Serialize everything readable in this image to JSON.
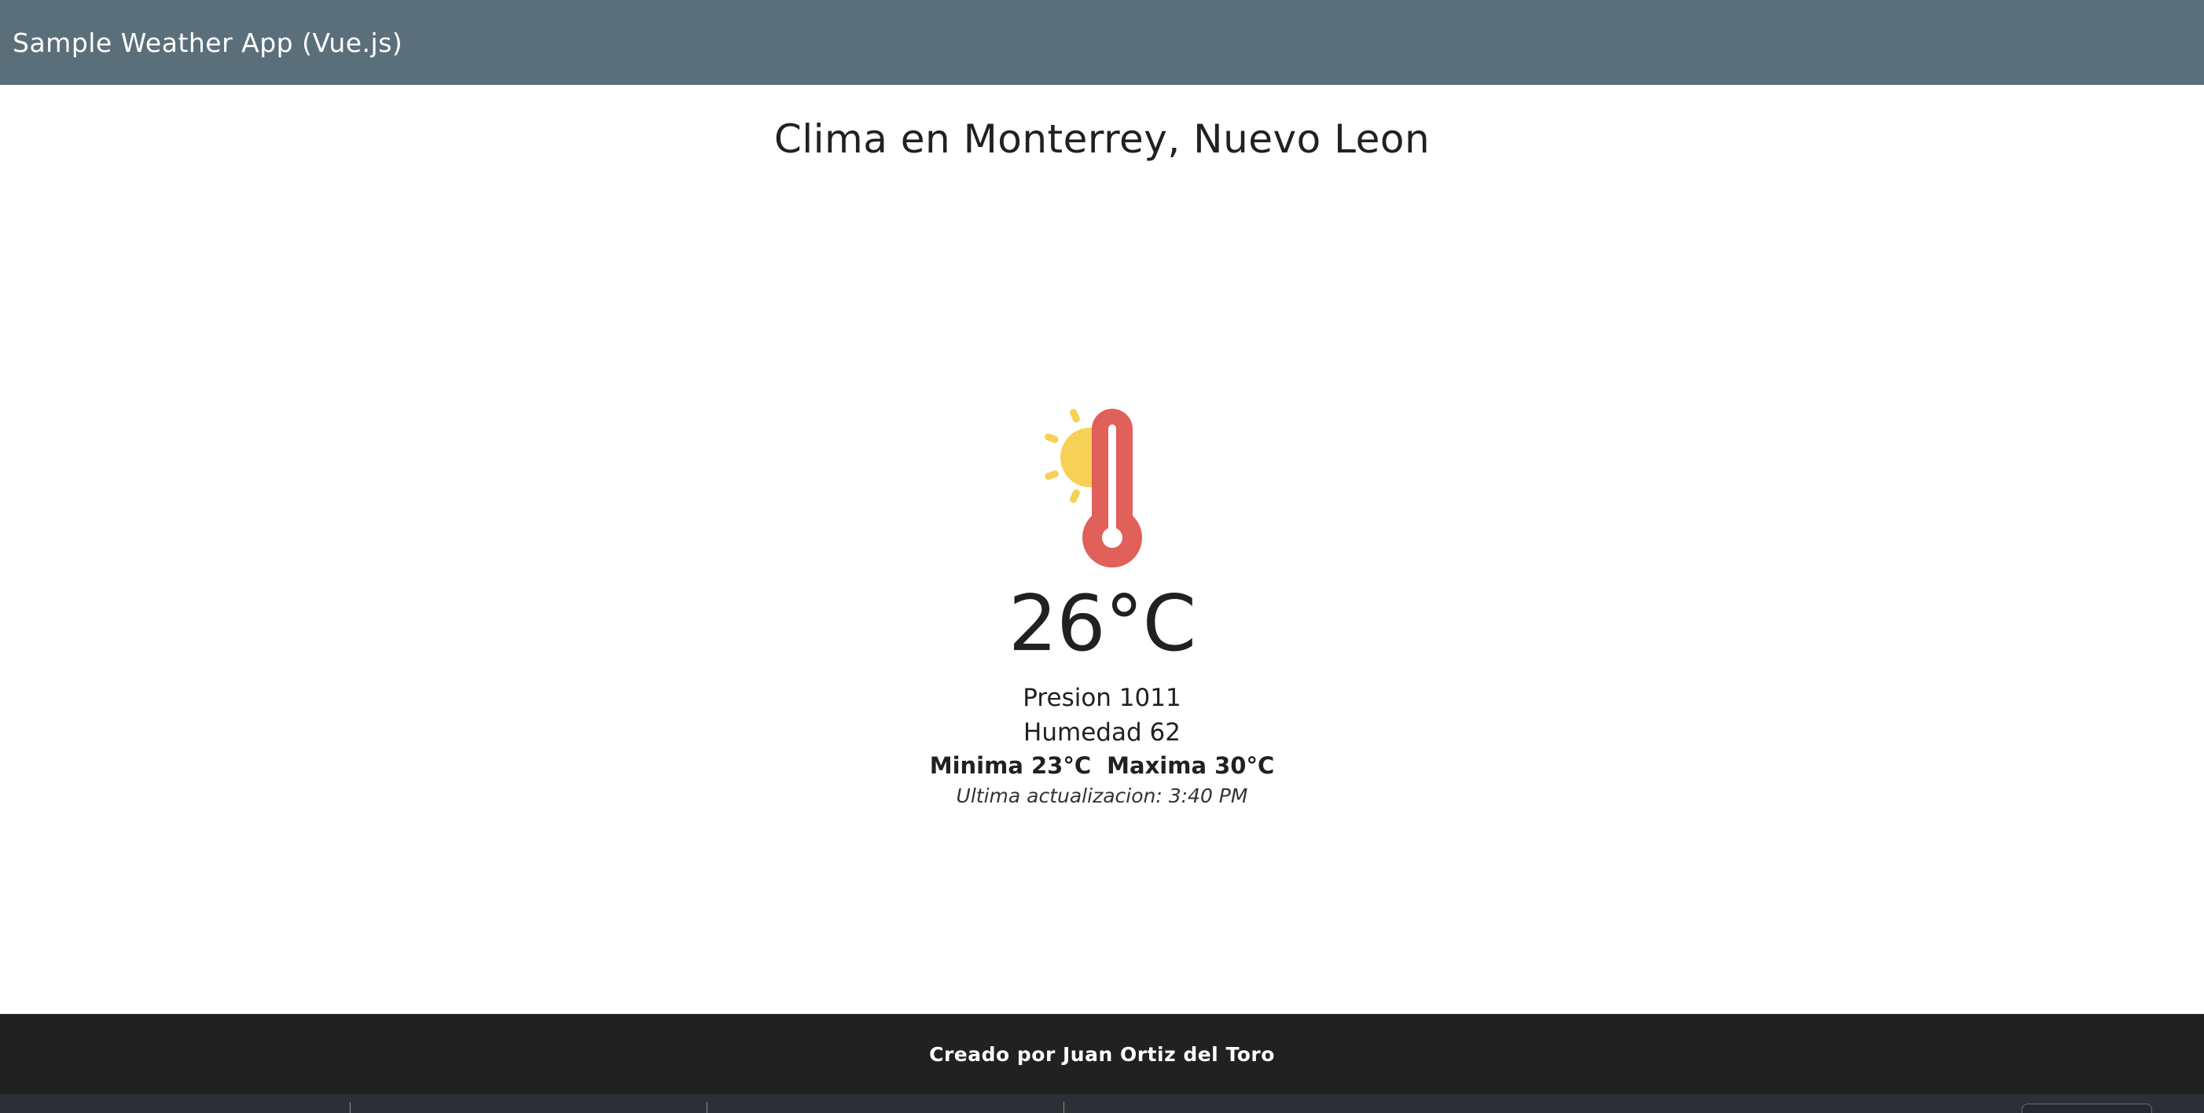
{
  "app_bar": {
    "title": "Sample Weather App (Vue.js)",
    "color": "#5b6f7b"
  },
  "weather": {
    "city_title": "Clima en Monterrey, Nuevo Leon",
    "icon": "sun-thermometer-icon",
    "temperature": "26°C",
    "pressure": "Presion 1011",
    "humidity": "Humedad 62",
    "minimum": "Minima 23°C",
    "maximum": "Maxima 30°C",
    "last_updated": "Ultima actualizacion: 3:40 PM"
  },
  "footer": {
    "credit": "Creado por Juan Ortiz del Toro",
    "color": "#212121"
  },
  "colors": {
    "sun": "#f6d155",
    "thermometer": "#e0605a"
  }
}
